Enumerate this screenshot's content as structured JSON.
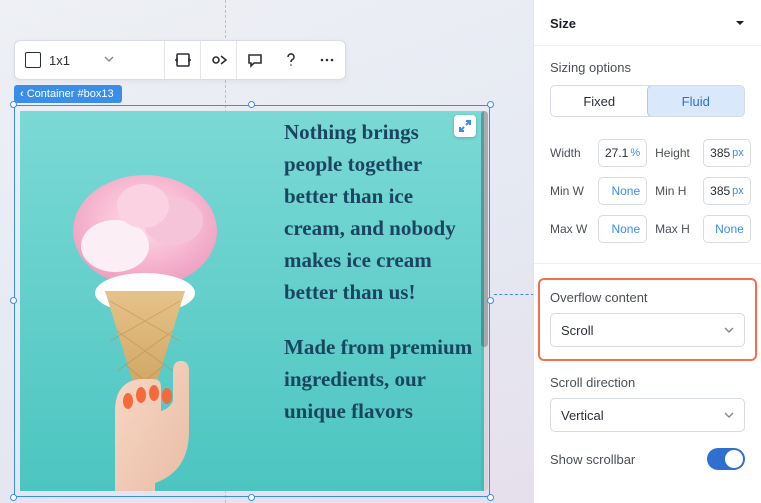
{
  "guides": {},
  "toolbar": {
    "size_label": "1x1"
  },
  "canvas": {
    "tag_label": "Container #box13",
    "paragraph1": "Nothing brings people together better than ice cream, and nobody makes ice cream better than us!",
    "paragraph2": "Made from premium ingredients, our unique flavors"
  },
  "panel": {
    "title": "Size",
    "sizing_label": "Sizing options",
    "seg": {
      "fixed": "Fixed",
      "fluid": "Fluid",
      "active": "fluid"
    },
    "dims": {
      "width_lbl": "Width",
      "width_val": "27.1",
      "width_unit": "%",
      "height_lbl": "Height",
      "height_val": "385",
      "height_unit": "px",
      "minw_lbl": "Min W",
      "minw_val": "None",
      "minh_lbl": "Min H",
      "minh_val": "385",
      "minh_unit": "px",
      "maxw_lbl": "Max W",
      "maxw_val": "None",
      "maxh_lbl": "Max H",
      "maxh_val": "None"
    },
    "overflow": {
      "label": "Overflow content",
      "value": "Scroll"
    },
    "scroll_dir": {
      "label": "Scroll direction",
      "value": "Vertical"
    },
    "show_scrollbar": {
      "label": "Show scrollbar",
      "on": true
    }
  }
}
